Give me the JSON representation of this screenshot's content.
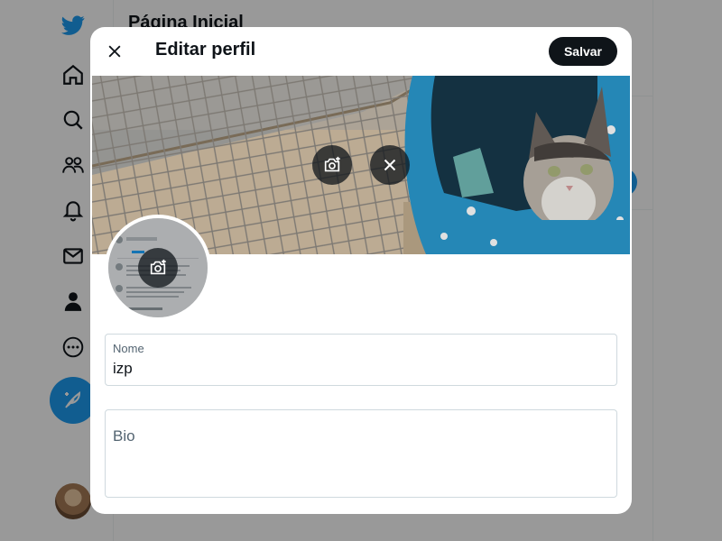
{
  "background": {
    "page_title": "Página Inicial",
    "nav_icons": [
      "twitter-logo-icon",
      "home-icon",
      "explore-icon",
      "communities-icon",
      "notifications-icon",
      "messages-icon",
      "profile-icon",
      "more-icon"
    ],
    "compose_icon": "feather-icon"
  },
  "modal": {
    "title": "Editar perfil",
    "save_label": "Salvar",
    "close_icon": "close-icon",
    "banner": {
      "add_photo_icon": "camera-plus-icon",
      "remove_photo_icon": "close-icon"
    },
    "avatar": {
      "add_photo_icon": "camera-plus-icon"
    },
    "fields": {
      "name": {
        "label": "Nome",
        "value": "izp"
      },
      "bio": {
        "label": "Bio",
        "value": ""
      }
    }
  },
  "colors": {
    "accent": "#1d9bf0",
    "text_primary": "#0f1419",
    "text_secondary": "#536471",
    "border": "#cfd9de",
    "overlay": "rgba(0,0,0,0.4)"
  }
}
